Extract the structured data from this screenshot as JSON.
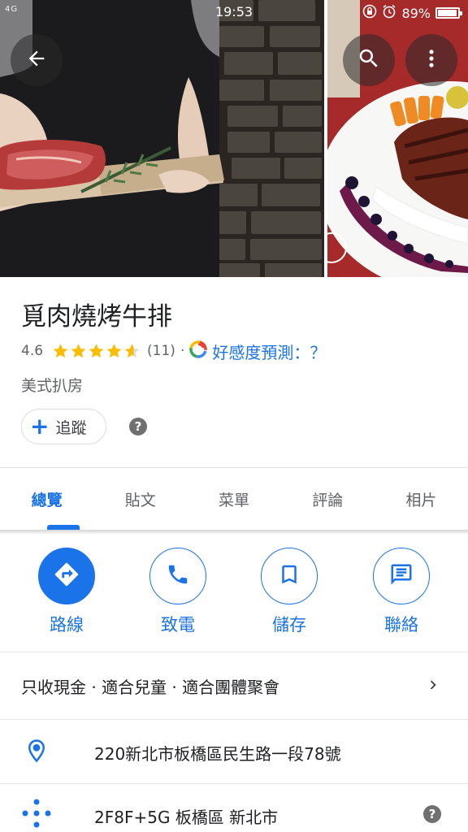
{
  "status_bar": {
    "network": "4G",
    "time": "19:53",
    "battery": "89%",
    "battery_level": 0.89
  },
  "header": {
    "back_icon": "arrow-back-icon",
    "search_icon": "search-icon",
    "more_icon": "more-vert-icon"
  },
  "place": {
    "name": "覓肉燒烤牛排",
    "rating": "4.6",
    "rating_value": 4.6,
    "review_count": "(11)",
    "separator": "·",
    "prediction_link": "好感度預測：？",
    "category": "美式扒房",
    "follow_label": "追蹤"
  },
  "tabs": [
    {
      "label": "總覽",
      "active": true
    },
    {
      "label": "貼文",
      "active": false
    },
    {
      "label": "菜單",
      "active": false
    },
    {
      "label": "評論",
      "active": false
    },
    {
      "label": "相片",
      "active": false
    }
  ],
  "actions": {
    "directions": "路線",
    "call": "致電",
    "save": "儲存",
    "message": "聯絡"
  },
  "details": {
    "amenities": "只收現金 · 適合兒童 · 適合團體聚會",
    "address": "220新北市板橋區民生路一段78號",
    "plus_code": "2F8F+5G 板橋區 新北市"
  },
  "colors": {
    "accent": "#1a73e8",
    "star": "#fbbc04",
    "text_primary": "#202124",
    "text_secondary": "#5f6368"
  }
}
